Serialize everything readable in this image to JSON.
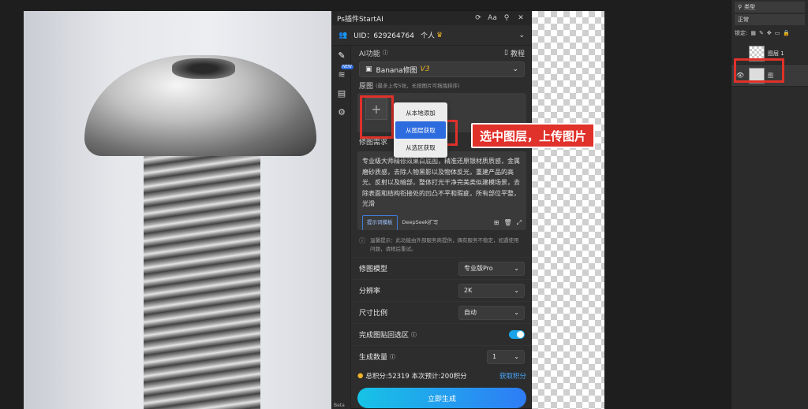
{
  "plugin": {
    "title": "Ps插件StartAI",
    "uid_label": "UID：629264764",
    "plan_tag": "个人",
    "ai_function_label": "AI功能",
    "tutorial_label": "教程",
    "model_select": "Banana修图",
    "model_version": "V3",
    "original_label": "原图",
    "original_note": "(最多上传5张，长按图片可拖拽排序)",
    "upload_menu": [
      "从本地添加",
      "从图层获取",
      "从选区获取"
    ],
    "edit_need_label": "修图需求",
    "prompt_text": "专业级大师精修效果白底图，精准还原银材质质感，金属磨砂质感，去除人物黑影以及物体反光，重建产品的高光、反射以及暗部，整体打光干净完美类似建模场景，去除表面和结构衔接处的凹凸不平和瑕疵，所有部位平整，光滑",
    "template_button": "提示词模板",
    "deepseek_button": "DeepSeek扩写",
    "notice": "温馨提示：此功能由外部服务商提供，偶有服务不稳定，如遇使用问题，请稍后重试。",
    "options": [
      {
        "label": "修图模型",
        "value": "专业版Pro"
      },
      {
        "label": "分辨率",
        "value": "2K"
      },
      {
        "label": "尺寸比例",
        "value": "自动"
      }
    ],
    "paste_back_label": "完成图贴回选区",
    "count_label": "生成数量",
    "count_value": "1",
    "points_text": "总积分:52319 本次预计:200积分",
    "get_points": "获取积分",
    "generate_button": "立即生成",
    "side_new_badge": "NEW",
    "beta": "Beta"
  },
  "callout_text": "选中图层，上传图片",
  "layers": {
    "search": "类型",
    "blend": "正常",
    "lock": "锁定:",
    "items": [
      "图层 1",
      "图"
    ]
  },
  "colors": {
    "accent": "#2d6cdf",
    "highlight": "#e0312a",
    "gold": "#f0b429"
  }
}
